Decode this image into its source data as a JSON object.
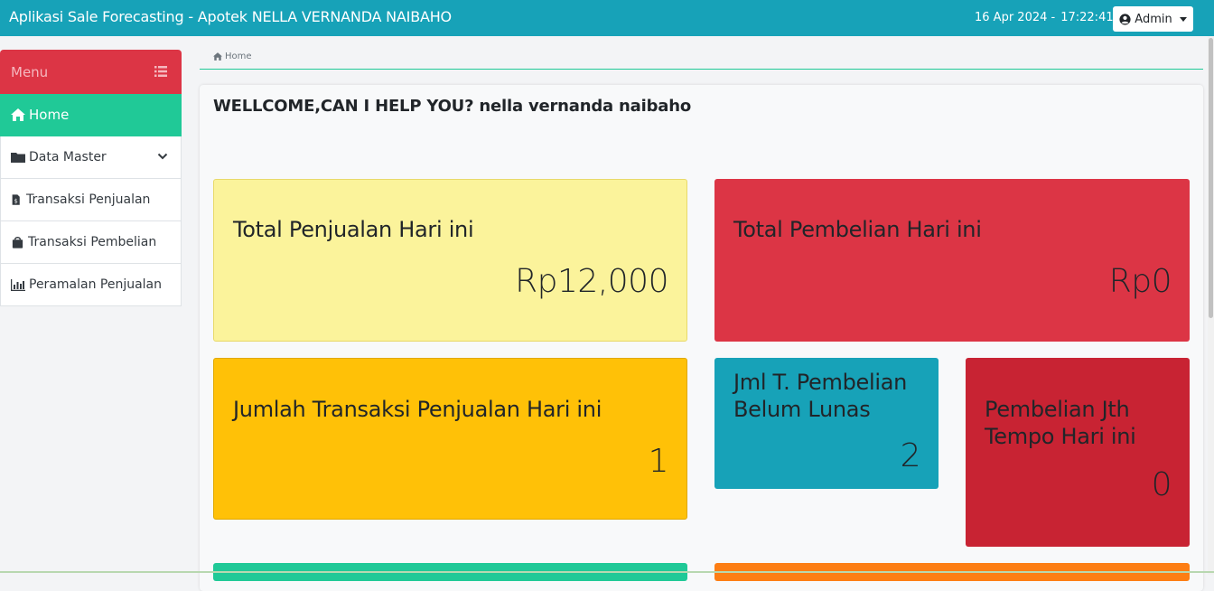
{
  "header": {
    "app_title": "Aplikasi Sale Forecasting - Apotek NELLA VERNANDA NAIBAHO",
    "date": "16 Apr 2024 -",
    "time": "17:22:41",
    "user_menu_label": "Admin"
  },
  "sidebar": {
    "menu_label": "Menu",
    "items": [
      {
        "label": "Home",
        "icon": "home-icon",
        "active": true
      },
      {
        "label": "Data Master",
        "icon": "folder-icon",
        "has_submenu": true
      },
      {
        "label": "Transaksi Penjualan",
        "icon": "invoice-icon"
      },
      {
        "label": "Transaksi Pembelian",
        "icon": "shopping-bag-icon"
      },
      {
        "label": "Peramalan Penjualan",
        "icon": "bar-chart-icon"
      }
    ]
  },
  "breadcrumb": {
    "home": "Home"
  },
  "main": {
    "welcome": "WELLCOME,CAN I HELP YOU? nella vernanda naibaho",
    "cards": [
      {
        "title": "Total Penjualan Hari ini",
        "value": "Rp12,000"
      },
      {
        "title": "Total Pembelian Hari ini",
        "value": "Rp0"
      },
      {
        "title": "Jumlah Transaksi Penjualan Hari ini",
        "value": "1"
      },
      {
        "title_line1": "Jml T. Pembelian",
        "title_line2": "Belum Lunas",
        "value": "2"
      },
      {
        "title_line1": "Pembelian Jth",
        "title_line2": "Tempo Hari ini",
        "value": "0"
      }
    ]
  },
  "colors": {
    "topbar": "#17a2b8",
    "menu_header": "#dc3545",
    "active_item": "#20c997",
    "card_yellow_light": "#fbf39b",
    "card_red": "#dc3545",
    "card_amber": "#ffc107",
    "card_cyan": "#17a2b8",
    "card_dark_red": "#c82333",
    "card_green": "#20c997",
    "card_orange": "#fd7e14"
  }
}
